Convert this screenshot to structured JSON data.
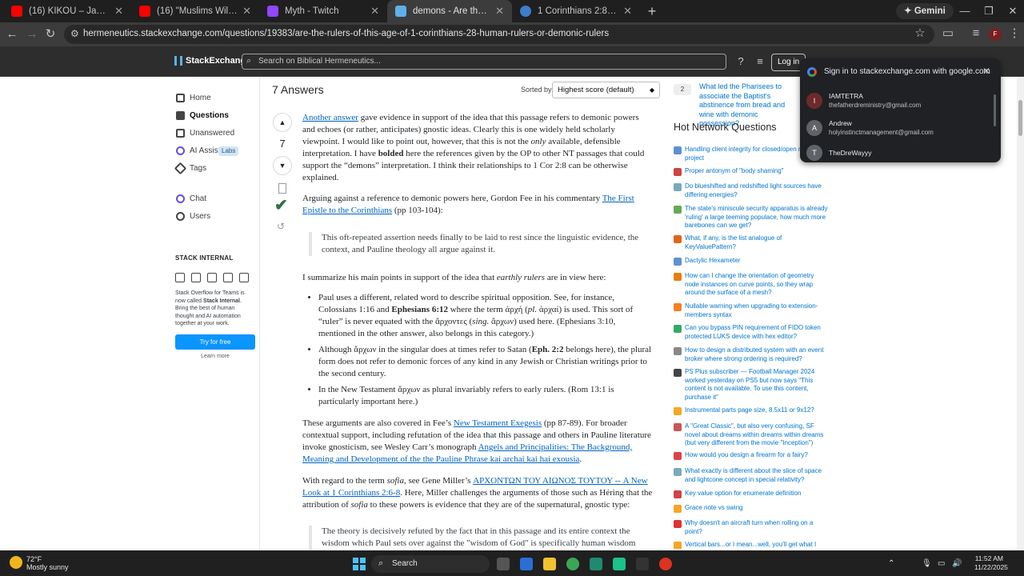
{
  "browser": {
    "tabs": [
      {
        "title": "(16) KIKOU – Japanese Zen Mu",
        "favicon_color": "#ff0000"
      },
      {
        "title": "(16) \"Muslims Will Be OFFENDE",
        "favicon_color": "#ff0000"
      },
      {
        "title": "Myth - Twitch",
        "favicon_color": "#9146ff"
      },
      {
        "title": "demons - Are the \"rulers of thi",
        "favicon_color": "#5eb1e6"
      },
      {
        "title": "1 Corinthians 2:8 None of the r",
        "favicon_color": "#3d7dca"
      }
    ],
    "new_tab": "+",
    "gemini_label": "Gemini",
    "url": "hermeneutics.stackexchange.com/questions/19383/are-the-rulers-of-this-age-of-1-corinthians-28-human-rulers-or-demonic-rulers"
  },
  "se_header": {
    "logo_text": "StackExchange",
    "search_placeholder": "Search on Biblical Hermeneutics...",
    "login_label": "Log in"
  },
  "sidebar": {
    "items": [
      {
        "label": "Home"
      },
      {
        "label": "Questions"
      },
      {
        "label": "Unanswered"
      },
      {
        "label": "AI Assist"
      },
      {
        "label": "Tags"
      },
      {
        "label": "Chat"
      },
      {
        "label": "Users"
      }
    ],
    "labs_badge": "Labs",
    "stack_internal": {
      "title": "STACK INTERNAL",
      "text_a": "Stack Overflow for Teams is now called ",
      "text_b": "Stack Internal",
      "text_c": ". Bring the best of human thought and AI automation together at your work.",
      "button": "Try for free",
      "link": "Learn more"
    }
  },
  "answers": {
    "count_label": "7 Answers",
    "sorted_by": "Sorted by:",
    "sort_value": "Highest score (default)",
    "score": "7"
  },
  "answer": {
    "p1": {
      "link": "Another answer",
      "a": " gave evidence in support of the idea that this passage refers to demonic powers and echoes (or rather, anticipates) gnostic ideas. Clearly this is one widely held scholarly viewpoint. I would like to point out, however, that this is not the ",
      "em": "only",
      "b": " available, defensible interpretation. I have ",
      "strong": "bolded",
      "c": " here the references given by the OP to other NT passages that could support the “demons” interpretation. I think their relationships to 1 Cor 2:8 can be otherwise explained."
    },
    "p2": {
      "a": "Arguing against a reference to demonic powers here, Gordon Fee in his commentary ",
      "link": "The First Epistle to the Corinthians",
      "b": " (pp 103-104):"
    },
    "quote1": "This oft-repeated assertion needs finally to be laid to rest since the linguistic evidence, the context, and Pauline theology all argue against it.",
    "p3": {
      "a": "I summarize his main points in support of the idea that ",
      "em": "earthly rulers",
      "b": " are in view here:"
    },
    "bullet1": {
      "a": "Paul uses a different, related word to describe spiritual opposition. See, for instance, Colossians 1:16 and ",
      "strong": "Ephesians 6:12",
      "b": " where the term ἀρχή (",
      "em1": "pl.",
      "c": " ἀρχαί) is used. This sort of “ruler” is never equated with the ἄρχοντες (",
      "em2": "sing.",
      "d": " ἄρχων) used here. (Ephesians 3:10, mentioned in the other answer, also belongs in this category.)"
    },
    "bullet2": {
      "a": "Although ἄρχων in the singular does at times refer to Satan (",
      "strong": "Eph. 2:2",
      "b": " belongs here), the plural form does not refer to demonic forces of any kind in any Jewish or Christian writings prior to the second century."
    },
    "bullet3": "In the New Testament ἄρχων as plural invariably refers to early rulers. (Rom 13:1 is particularly important here.)",
    "p4": {
      "a": "These arguments are also covered in Fee’s ",
      "link1": "New Testament Exegesis",
      "b": " (pp 87-89). For broader contextual support, including refutation of the idea that this passage and others in Pauline literature invoke gnosticism, see Wesley Carr’s monograph ",
      "link2": "Angels and Principalities: The Background, Meaning and Development of the the Pauline Phrase kai archai kai hai exousia",
      "c": "."
    },
    "p5": {
      "a": "With regard to the term ",
      "em1": "sofia",
      "b": ", see Gene Miller’s ",
      "link": "ΑΡΧΟΝΤΩΝ ΤΟΥ ΑΙΩΝΟΣ ΤΟΥΤΟΥ -- A New Look at 1 Corinthians 2:6-8",
      "c": ". Here, Miller challenges the arguments of those such as Héring that the attribution of ",
      "em2": "sofia",
      "d": " to these powers is evidence that they are of the supernatural, gnostic type:"
    },
    "quote2": "The theory is decisively refuted by the fact that in this passage and its entire context the wisdom which Paul sets over against the \"wisdom of God\" is specifically human wisdom"
  },
  "related": {
    "num": "2",
    "text": "What led the Pharisees to associate the Baptist's abstinence from bread and wine with demonic possession?"
  },
  "hnq": {
    "title": "Hot Network Questions",
    "items": [
      {
        "text": "Handling client integrity for closed/open mixed project",
        "color": "#5e8fd4"
      },
      {
        "text": "Proper antonym of \"body shaming\"",
        "color": "#c44"
      },
      {
        "text": "Do blueshifted and redshifted light sources have differing energies?",
        "color": "#7ab"
      },
      {
        "text": "The state's miniscule security apparatus is already 'ruling' a large teeming populace, how much more barebones can we get?",
        "color": "#6a5"
      },
      {
        "text": "What, if any, is the list analogue of KeyValuePattern?",
        "color": "#e0641c"
      },
      {
        "text": "Dactylic Hexameter",
        "color": "#5e8fd4"
      },
      {
        "text": "How can I change the orientation of geometry node instances on curve points, so they wrap around the surface of a mesh?",
        "color": "#e87d0d"
      },
      {
        "text": "Nullable warning when upgrading to extension-members syntax",
        "color": "#f48024"
      },
      {
        "text": "Can you bypass PIN requirement of FIDO token protected LUKS device with hex editor?",
        "color": "#3a6"
      },
      {
        "text": "How to design a distributed system with an event broker where strong ordering is required?",
        "color": "#888"
      },
      {
        "text": "PS Plus subscriber — Football Manager 2024 worked yesterday on PS5 but now says \"This content is not available. To use this content, purchase it\"",
        "color": "#444"
      },
      {
        "text": "Instrumental parts page size, 8.5x11 or 9x12?",
        "color": "#f5a623"
      },
      {
        "text": "A \"Great Classic\", but also very confusing, SF novel about dreams within dreams within dreams (but very different from the movie \"Inception\")",
        "color": "#c55"
      },
      {
        "text": "How would you design a firearm for a fairy?",
        "color": "#d44"
      },
      {
        "text": "What exactly is different about the slice of space and lightcone concept in special relativity?",
        "color": "#7ab"
      },
      {
        "text": "Key value option for enumerate definition",
        "color": "#c44"
      },
      {
        "text": "Grace note vs swing",
        "color": "#f5a623"
      },
      {
        "text": "Why doesn't an aircraft turn when rolling on a point?",
        "color": "#d33"
      },
      {
        "text": "Vertical bars...or I mean...well, you'll get what I",
        "color": "#f5a623"
      }
    ]
  },
  "google_popup": {
    "title": "Sign in to stackexchange.com with google.com",
    "accounts": [
      {
        "initial": "I",
        "name": "IAMTETRA",
        "email": "thefatherdreministry@gmail.com"
      },
      {
        "initial": "A",
        "name": "Andrew",
        "email": "holyinstinctmanagement@gmail.com"
      },
      {
        "initial": "T",
        "name": "TheDreWayyy",
        "email": ""
      }
    ]
  },
  "taskbar": {
    "temp": "72°F",
    "weather": "Mostly sunny",
    "search": "Search",
    "time": "11:52 AM",
    "date": "11/22/2025"
  }
}
